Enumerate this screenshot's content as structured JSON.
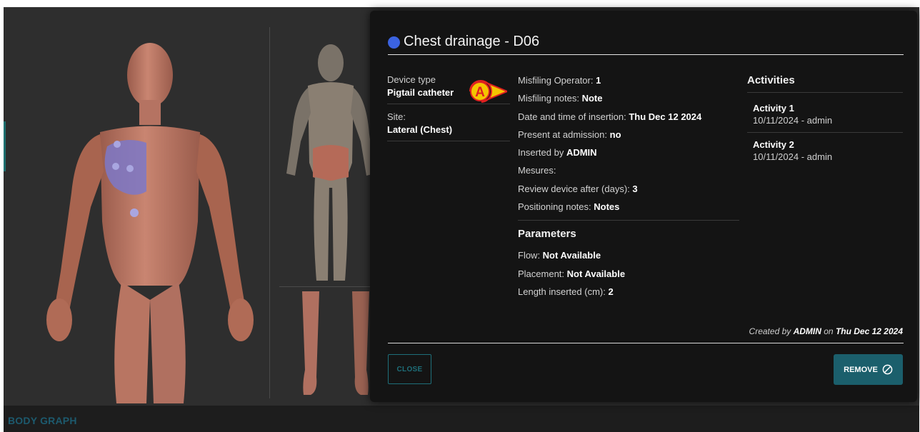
{
  "bottom_bar": {
    "label": "BODY GRAPH"
  },
  "modal": {
    "title": "Chest drainage - D06",
    "dot_color": "#3b63e0",
    "left": {
      "device_type_label": "Device type",
      "device_type_value": "Pigtail catheter",
      "site_label": "Site:",
      "site_value": "Lateral (Chest)"
    },
    "details": [
      {
        "label": "Misfiling Operator: ",
        "value": "1"
      },
      {
        "label": "Misfiling notes: ",
        "value": "Note"
      },
      {
        "label": "Date and time of insertion: ",
        "value": "Thu Dec 12 2024"
      },
      {
        "label": "Present at admission: ",
        "value": "no"
      },
      {
        "label": "Inserted by ",
        "value": "ADMIN"
      },
      {
        "label": "Mesures:",
        "value": ""
      },
      {
        "label": "Review device after (days): ",
        "value": "3"
      },
      {
        "label": "Positioning notes: ",
        "value": "Notes"
      }
    ],
    "parameters_heading": "Parameters",
    "parameters": [
      {
        "label": "Flow: ",
        "value": "Not Available"
      },
      {
        "label": "Placement: ",
        "value": "Not Available"
      },
      {
        "label": "Length inserted (cm): ",
        "value": "2"
      }
    ],
    "activities_heading": "Activities",
    "activities": [
      {
        "title": "Activity 1",
        "subtitle": "10/11/2024 - admin"
      },
      {
        "title": "Activity 2",
        "subtitle": "10/11/2024 - admin"
      }
    ],
    "created": {
      "prefix": "Created by ",
      "user": "ADMIN",
      "mid": " on ",
      "date": "Thu Dec 12 2024"
    },
    "close_label": "CLOSE",
    "remove_label": "REMOVE",
    "remove_icon": "ban-icon"
  },
  "callout": {
    "letter": "A",
    "color": "#f5c400",
    "border_color": "#e02020"
  },
  "colors": {
    "accent": "#1b5f6c",
    "skin": "#c07a63",
    "highlight": "#7d78c8"
  }
}
